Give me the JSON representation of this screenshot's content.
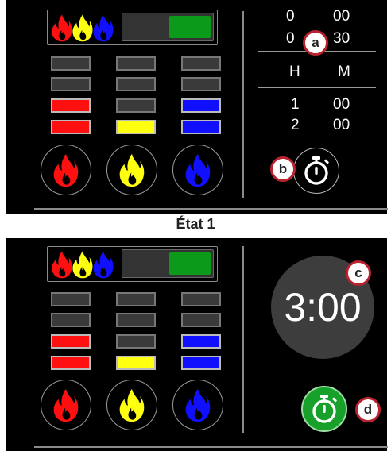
{
  "states": [
    {
      "timer": {
        "rows": [
          [
            "0",
            "00"
          ],
          [
            "0",
            "30"
          ]
        ],
        "header": [
          "H",
          "M"
        ],
        "bottom_rows": [
          [
            "1",
            "00"
          ],
          [
            "2",
            "00"
          ]
        ]
      },
      "markers": {
        "a": "a",
        "b": "b"
      }
    },
    {
      "countdown": "3:00",
      "markers": {
        "c": "c",
        "d": "d"
      }
    }
  ],
  "state_label": "État 1",
  "colors": {
    "red": "#ff1010",
    "yellow": "#ffff10",
    "blue": "#1010ff",
    "green": "#0b9a1a",
    "marker_border": "#b8232f"
  },
  "icons": {
    "flame": "flame-icon",
    "stopwatch": "stopwatch-icon"
  }
}
